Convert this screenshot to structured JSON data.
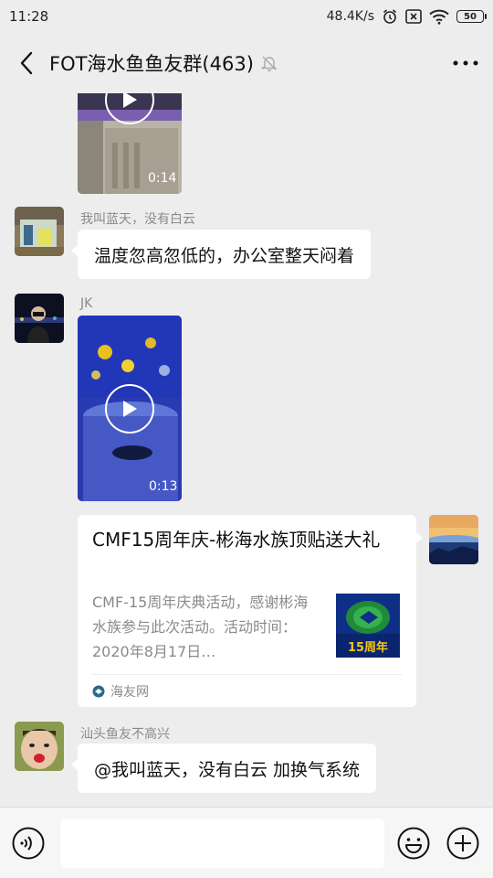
{
  "status_bar": {
    "time": "11:28",
    "net_speed": "48.4K/s",
    "battery": "50",
    "icons": [
      "alarm-icon",
      "sim-off-icon",
      "wifi-icon",
      "battery-icon"
    ]
  },
  "header": {
    "title": "FOT海水鱼鱼友群(463)",
    "back_icon": "chevron-left-icon",
    "mute_icon": "bell-off-icon",
    "more_icon": "ellipsis-icon"
  },
  "messages": [
    {
      "type": "video",
      "duration": "0:14"
    },
    {
      "type": "text",
      "sender": "我叫蓝天，没有白云",
      "text": "温度忽高忽低的，办公室整天闷着"
    },
    {
      "type": "video",
      "sender": "JK",
      "duration": "0:13"
    },
    {
      "type": "link",
      "title": "CMF15周年庆-彬海水族顶贴送大礼",
      "description": "CMF-15周年庆典活动，感谢彬海水族参与此次活动。活动时间：2020年8月17日…",
      "thumb_text": "15周年",
      "source": "海友网"
    },
    {
      "type": "text",
      "sender": "汕头鱼友不高兴",
      "text": "@我叫蓝天，没有白云 加换气系统"
    }
  ],
  "input_bar": {
    "placeholder": "",
    "icons": [
      "voice-icon",
      "emoji-icon",
      "plus-icon"
    ]
  },
  "colors": {
    "background": "#ededed",
    "bubble": "#ffffff",
    "sender_gray": "#8a8a8a"
  }
}
